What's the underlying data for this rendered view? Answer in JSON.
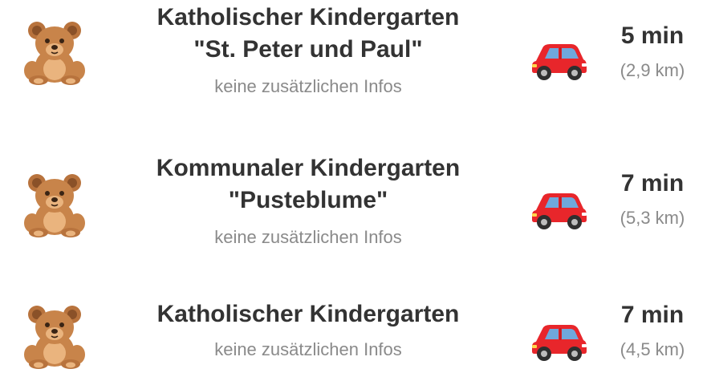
{
  "kindergartens": [
    {
      "icon": "teddy-bear-icon",
      "title_line1": "Katholischer Kindergarten",
      "title_line2": "\"St. Peter und Paul\"",
      "info": "keine zusätzlichen Infos",
      "transport_icon": "car-icon",
      "duration": "5 min",
      "distance": "(2,9 km)"
    },
    {
      "icon": "teddy-bear-icon",
      "title_line1": "Kommunaler Kindergarten",
      "title_line2": "\"Pusteblume\"",
      "info": "keine zusätzlichen Infos",
      "transport_icon": "car-icon",
      "duration": "7 min",
      "distance": "(5,3 km)"
    },
    {
      "icon": "teddy-bear-icon",
      "title_line1": "Katholischer Kindergarten",
      "info": "keine zusätzlichen Infos",
      "transport_icon": "car-icon",
      "duration": "7 min",
      "distance": "(4,5 km)"
    }
  ],
  "colors": {
    "car_red": "#e8262b",
    "bear_brown": "#c8844a",
    "bear_light": "#eab47e",
    "title_text": "#333333",
    "muted_text": "#8a8a8a"
  }
}
